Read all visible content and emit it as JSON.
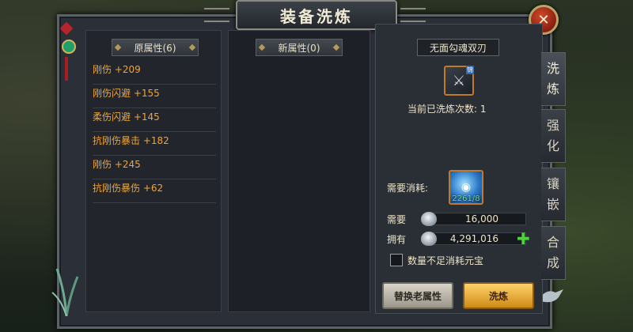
{
  "window": {
    "title": "装备洗炼"
  },
  "close_icon": "close-icon",
  "left_panel": {
    "header": "原属性(6)",
    "attributes": [
      "刚伤 +209",
      "刚伤闪避 +155",
      "柔伤闪避 +145",
      "抗刚伤暴击 +182",
      "刚伤 +245",
      "抗刚伤暴伤 +62"
    ]
  },
  "middle_panel": {
    "header": "新属性(0)"
  },
  "right_panel": {
    "equipment_name": "无面勾魂双刃",
    "equipment_tag": "锦",
    "wash_count_text": "当前已洗炼次数: 1",
    "cost_label": "需要消耗:",
    "stone_count": "2261/8",
    "need_label": "需要",
    "need_value": "16,000",
    "have_label": "拥有",
    "have_value": "4,291,016",
    "checkbox_label": "数量不足消耗元宝",
    "checkbox_checked": false,
    "replace_button": "替换老属性",
    "wash_button": "洗炼"
  },
  "side_tabs": [
    {
      "label": "洗\n炼",
      "active": true
    },
    {
      "label": "强\n化",
      "active": false
    },
    {
      "label": "镶\n嵌",
      "active": false
    },
    {
      "label": "合\n成",
      "active": false
    }
  ],
  "colors": {
    "attribute_text": "#f0a437",
    "stone_count": "#63e36b",
    "plus_icon": "#4fd23e",
    "gold_button": "#e0a030"
  }
}
